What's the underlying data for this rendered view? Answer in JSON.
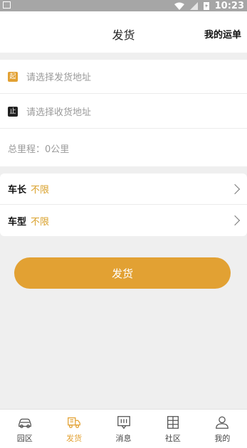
{
  "status_bar": {
    "time": "10:23"
  },
  "header": {
    "title": "发货",
    "waybill_link": "我的运单"
  },
  "address": {
    "origin_badge": "起",
    "origin_placeholder": "请选择发货地址",
    "dest_badge": "止",
    "dest_placeholder": "请选择收货地址",
    "distance": "总里程：0公里"
  },
  "options": {
    "length_label": "车长",
    "length_value": "不限",
    "type_label": "车型",
    "type_value": "不限"
  },
  "submit_label": "发货",
  "tabs": [
    {
      "label": "园区",
      "icon": "car-icon"
    },
    {
      "label": "发货",
      "icon": "truck-icon",
      "active": true
    },
    {
      "label": "消息",
      "icon": "message-icon"
    },
    {
      "label": "社区",
      "icon": "community-icon"
    },
    {
      "label": "我的",
      "icon": "user-icon"
    }
  ],
  "colors": {
    "accent": "#e2a133",
    "status_bar": "#a6a6a6",
    "background": "#efefef"
  }
}
